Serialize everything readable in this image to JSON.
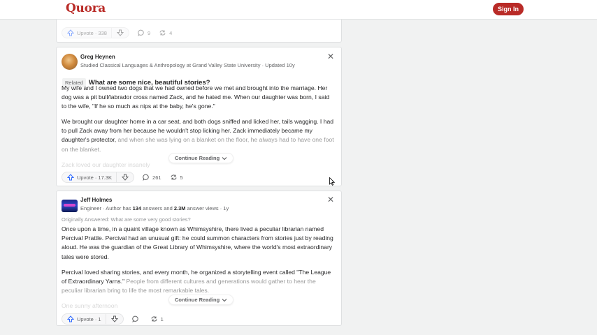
{
  "header": {
    "logo": "Quora",
    "signin_label": "Sign In"
  },
  "top_card": {
    "upvote_label": "Upvote · 338",
    "comments": "9",
    "shares": "4"
  },
  "cards": [
    {
      "author": "Greg Heynen",
      "credential": "Studied Classical Languages & Anthropology at Grand Valley State University · Updated 10y",
      "related_tag": "Related",
      "question": "What are some nice, beautiful stories?",
      "para1": "My wife and I owned two dogs that we had owned before we met and brought into the marriage. Her dog was a pit bull/labrador cross named Zack, and he hated me. When our daughter was born, I said to the wife, \"If he so much as nips at the baby, he's gone.\"",
      "para2_a": "We brought our daughter home in a car seat, and both dogs sniffed and licked her, tails wagging. I had to pull Zack away from her because he wouldn't stop licking her. Zack immediately became my daughter's protector,",
      "para2_b": " and when she was lying on a blanket on the floor, he always had to have one foot on the blanket.",
      "para3": "Zack loved our daughter insanely",
      "continue_label": "Continue Reading",
      "upvote_label": "Upvote · 17.3K",
      "comments": "261",
      "shares": "5"
    },
    {
      "author": "Jeff Holmes",
      "credential_prefix": "Engineer · Author has ",
      "answers": "134",
      "credential_mid": " answers and ",
      "views": "2.3M",
      "credential_suffix": " answer views · 1y",
      "originally": "Originally Answered: What are some very good stories?",
      "para1": "Once upon a time, in a quaint village known as Whimsyshire, there lived a peculiar librarian named Percival Prattle. Percival had an unusual gift: he could summon characters from stories just by reading aloud. He was the guardian of the Great Library of Whimsyshire, where the world's most extraordinary tales were stored.",
      "para2_a": "Percival loved sharing stories, and every month, he organized a storytelling event called \"The League of Extraordinary Yarns.\"",
      "para2_b": " People from different cultures and generations would gather to hear the peculiar librarian bring to life the most remarkable tales.",
      "para3": "One sunny afternoon",
      "continue_label": "Continue Reading",
      "upvote_label": "Upvote · 1",
      "comments": "",
      "shares": "1"
    }
  ]
}
